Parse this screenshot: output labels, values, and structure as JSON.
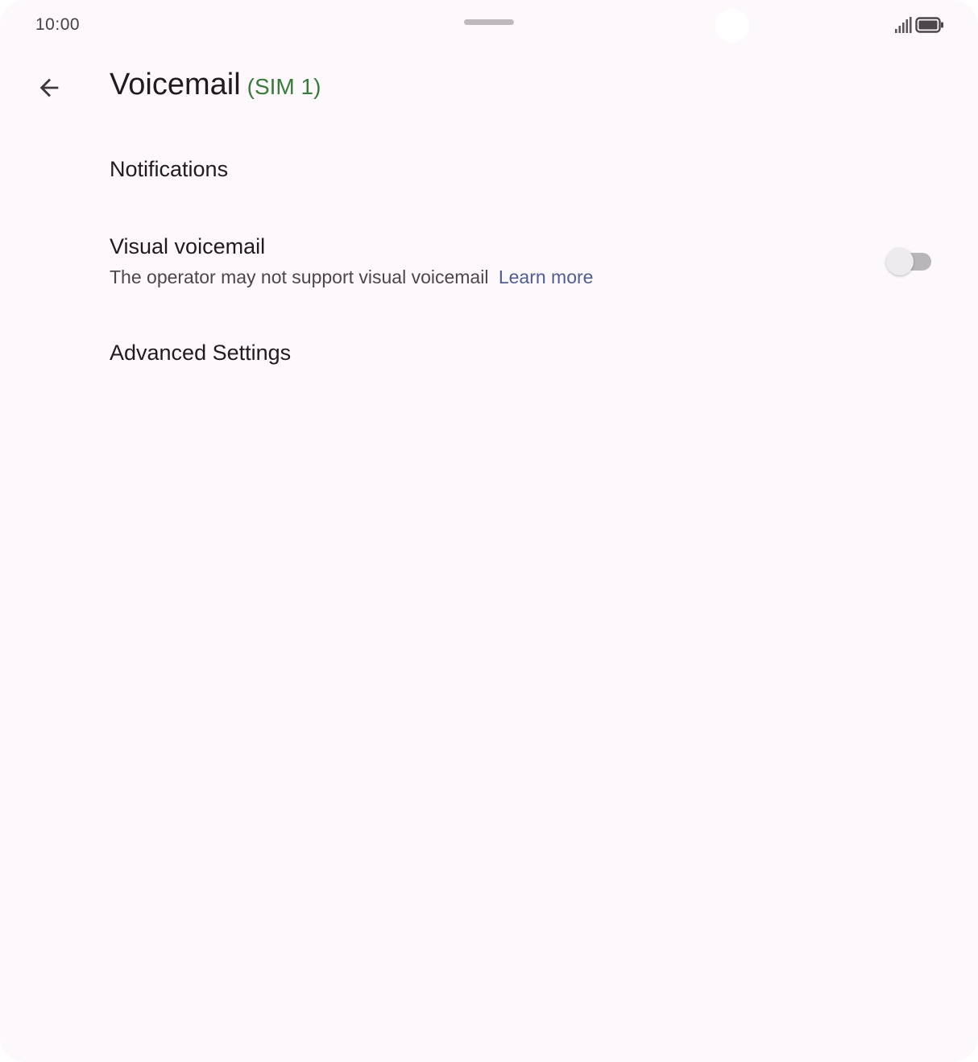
{
  "status_bar": {
    "time": "10:00",
    "icons": [
      "signal-icon",
      "battery-icon"
    ]
  },
  "app_bar": {
    "back_icon": "arrow-back-icon",
    "title": "Voicemail",
    "title_suffix": "(SIM 1)"
  },
  "preferences": {
    "notifications": {
      "title": "Notifications"
    },
    "visual_voicemail": {
      "title": "Visual voicemail",
      "summary": "The operator may not support visual voicemail",
      "link_label": "Learn more",
      "enabled": false
    },
    "advanced_settings": {
      "title": "Advanced Settings"
    }
  },
  "colors": {
    "background": "#fcf8fb",
    "sim_label": "#3a7a3a",
    "link": "#4f5d93",
    "text_primary": "#1f1b1e",
    "text_secondary": "#4b464b"
  }
}
